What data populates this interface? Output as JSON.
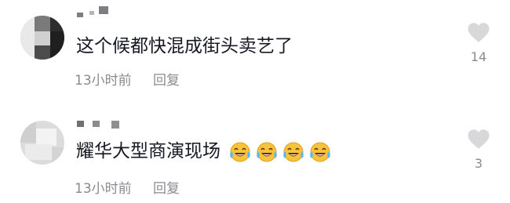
{
  "comments": [
    {
      "text": "这个候都快混成街头卖艺了",
      "time": "13小时前",
      "reply_label": "回复",
      "likes": "14",
      "emojis": []
    },
    {
      "text": "耀华大型商演现场",
      "time": "13小时前",
      "reply_label": "回复",
      "likes": "3",
      "emojis": [
        "laughing-crying-emoji",
        "laughing-crying-emoji",
        "laughing-crying-emoji",
        "laughing-crying-emoji"
      ]
    }
  ],
  "colors": {
    "text": "#161823",
    "meta": "#8a8b91",
    "like_icon": "#d8d8db"
  },
  "icons": {
    "like": "heart-icon"
  }
}
